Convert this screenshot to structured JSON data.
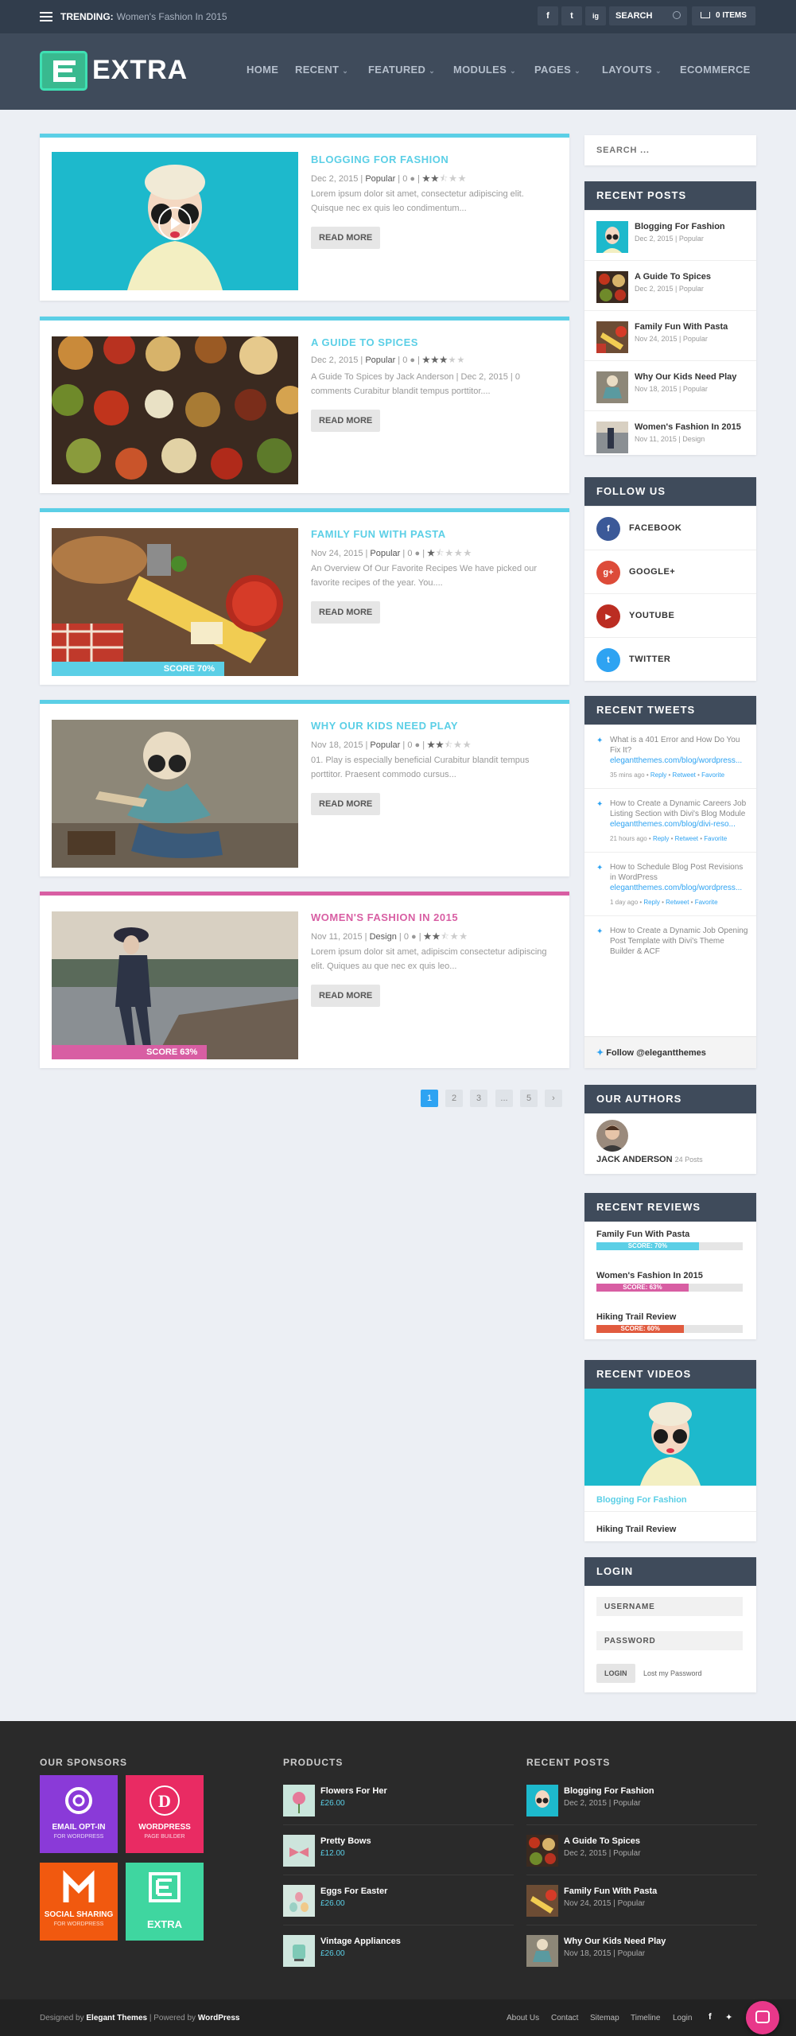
{
  "topbar": {
    "trending_label": "TRENDING:",
    "trending_text": "Women's Fashion In 2015",
    "social": [
      "f",
      "t",
      "ig"
    ],
    "search_placeholder": "SEARCH",
    "cart_label": "0 ITEMS"
  },
  "header": {
    "logo_text": "EXTRA",
    "nav": [
      "HOME",
      "RECENT",
      "FEATURED",
      "MODULES",
      "PAGES",
      "LAYOUTS",
      "ECOMMERCE"
    ]
  },
  "posts": [
    {
      "title": "BLOGGING FOR FASHION",
      "date": "Dec 2, 2015",
      "cat": "Popular",
      "comments": "0",
      "rating": 2.5,
      "excerpt": "Lorem ipsum dolor sit amet, consectetur adipiscing elit. Quisque nec ex quis leo condimentum...",
      "read_more": "READ MORE"
    },
    {
      "title": "A GUIDE TO SPICES",
      "date": "Dec 2, 2015",
      "cat": "Popular",
      "comments": "0",
      "rating": 3,
      "excerpt": "A Guide To Spices by Jack Anderson | Dec 2, 2015 | 0 comments Curabitur blandit tempus porttitor....",
      "read_more": "READ MORE"
    },
    {
      "title": "FAMILY FUN WITH PASTA",
      "date": "Nov 24, 2015",
      "cat": "Popular",
      "comments": "0",
      "rating": 1.5,
      "excerpt": "An Overview Of Our Favorite Recipes We have picked our favorite recipes of the year. You....",
      "read_more": "READ MORE",
      "score": "SCORE 70%",
      "score_value": 0.7
    },
    {
      "title": "WHY OUR KIDS NEED PLAY",
      "date": "Nov 18, 2015",
      "cat": "Popular",
      "comments": "0",
      "rating": 2.5,
      "excerpt": "01. Play is especially beneficial Curabitur blandit tempus porttitor. Praesent commodo cursus...",
      "read_more": "READ MORE"
    },
    {
      "title": "WOMEN'S FASHION IN 2015",
      "date": "Nov 11, 2015",
      "cat": "Design",
      "comments": "0",
      "rating": 2.5,
      "excerpt": "Lorem ipsum dolor sit amet, adipiscim consectetur adipiscing elit. Quiques au que nec ex quis leo...",
      "read_more": "READ MORE",
      "score": "SCORE 63%",
      "score_value": 0.63
    }
  ],
  "pagination": [
    "1",
    "2",
    "3",
    "...",
    "5",
    "›"
  ],
  "sidebar": {
    "search_placeholder": "SEARCH ...",
    "recent_posts_title": "RECENT POSTS",
    "recent_posts": [
      {
        "title": "Blogging For Fashion",
        "meta": "Dec 2, 2015 | Popular"
      },
      {
        "title": "A Guide To Spices",
        "meta": "Dec 2, 2015 | Popular"
      },
      {
        "title": "Family Fun With Pasta",
        "meta": "Nov 24, 2015 | Popular"
      },
      {
        "title": "Why Our Kids Need Play",
        "meta": "Nov 18, 2015 | Popular"
      },
      {
        "title": "Women's Fashion In 2015",
        "meta": "Nov 11, 2015 | Design"
      }
    ],
    "follow_title": "FOLLOW US",
    "follow": [
      {
        "label": "FACEBOOK",
        "glyph": "f",
        "color": "#3b5998"
      },
      {
        "label": "GOOGLE+",
        "glyph": "g+",
        "color": "#dd4b39"
      },
      {
        "label": "YOUTUBE",
        "glyph": "▶",
        "color": "#bb2d22"
      },
      {
        "label": "TWITTER",
        "glyph": "t",
        "color": "#2ea3f2"
      }
    ],
    "tweets_title": "RECENT TWEETS",
    "tweets": [
      {
        "text": "What is a 401 Error and How Do You Fix It?",
        "link": "elegantthemes.com/blog/wordpress...",
        "ago": "35 mins ago"
      },
      {
        "text": "How to Create a Dynamic Careers Job Listing Section with Divi's Blog Module",
        "link": "elegantthemes.com/blog/divi-reso...",
        "ago": "21 hours ago"
      },
      {
        "text": "How to Schedule Blog Post Revisions in WordPress",
        "link": "elegantthemes.com/blog/wordpress...",
        "ago": "1 day ago"
      },
      {
        "text": "How to Create a Dynamic Job Opening Post Template with Divi's Theme Builder & ACF",
        "link": "",
        "ago": ""
      }
    ],
    "tweet_actions": {
      "reply": "Reply",
      "retweet": "Retweet",
      "favorite": "Favorite"
    },
    "follow_handle": "Follow @elegantthemes",
    "authors_title": "OUR AUTHORS",
    "author_name": "JACK ANDERSON",
    "author_posts": "24 Posts",
    "reviews_title": "RECENT REVIEWS",
    "reviews": [
      {
        "title": "Family Fun With Pasta",
        "score": "SCORE: 70%",
        "value": 0.7,
        "color": "#5bcfe6"
      },
      {
        "title": "Women's Fashion In 2015",
        "score": "SCORE: 63%",
        "value": 0.63,
        "color": "#d85ea3"
      },
      {
        "title": "Hiking Trail Review",
        "score": "SCORE: 60%",
        "value": 0.6,
        "color": "#e15b3f"
      }
    ],
    "videos_title": "RECENT VIDEOS",
    "videos": [
      "Blogging For Fashion",
      "Hiking Trail Review"
    ],
    "login_title": "LOGIN",
    "username_placeholder": "USERNAME",
    "password_placeholder": "PASSWORD",
    "login_button": "LOGIN",
    "lost_password": "Lost my Password"
  },
  "footer": {
    "sponsors_title": "OUR SPONSORS",
    "sponsors": [
      {
        "name": "EMAIL OPT-IN",
        "sub": "FOR WORDPRESS",
        "color": "#8a3ad8"
      },
      {
        "name": "WORDPRESS",
        "sub": "PAGE BUILDER",
        "color": "#e92b63"
      },
      {
        "name": "SOCIAL SHARING",
        "sub": "FOR WORDPRESS",
        "color": "#f1590f"
      },
      {
        "name": "EXTRA",
        "sub": "",
        "color": "#3fd6a0"
      }
    ],
    "products_title": "PRODUCTS",
    "products": [
      {
        "title": "Flowers For Her",
        "price": "£26.00"
      },
      {
        "title": "Pretty Bows",
        "price": "£12.00"
      },
      {
        "title": "Eggs For Easter",
        "price": "£26.00"
      },
      {
        "title": "Vintage Appliances",
        "price": "£26.00"
      }
    ],
    "recent_title": "RECENT POSTS",
    "recent": [
      {
        "title": "Blogging For Fashion",
        "meta": "Dec 2, 2015 | Popular"
      },
      {
        "title": "A Guide To Spices",
        "meta": "Dec 2, 2015 | Popular"
      },
      {
        "title": "Family Fun With Pasta",
        "meta": "Nov 24, 2015 | Popular"
      },
      {
        "title": "Why Our Kids Need Play",
        "meta": "Nov 18, 2015 | Popular"
      }
    ]
  },
  "bottom": {
    "designed_prefix": "Designed by",
    "designed_by": "Elegant Themes",
    "powered_prefix": "| Powered by",
    "powered_by": "WordPress",
    "links": [
      "About Us",
      "Contact",
      "Sitemap",
      "Timeline",
      "Login"
    ]
  },
  "colors": {
    "accent": "#5bcfe6",
    "pink": "#d85ea3",
    "dark": "#3f4b5b",
    "link": "#2ea3f2"
  }
}
